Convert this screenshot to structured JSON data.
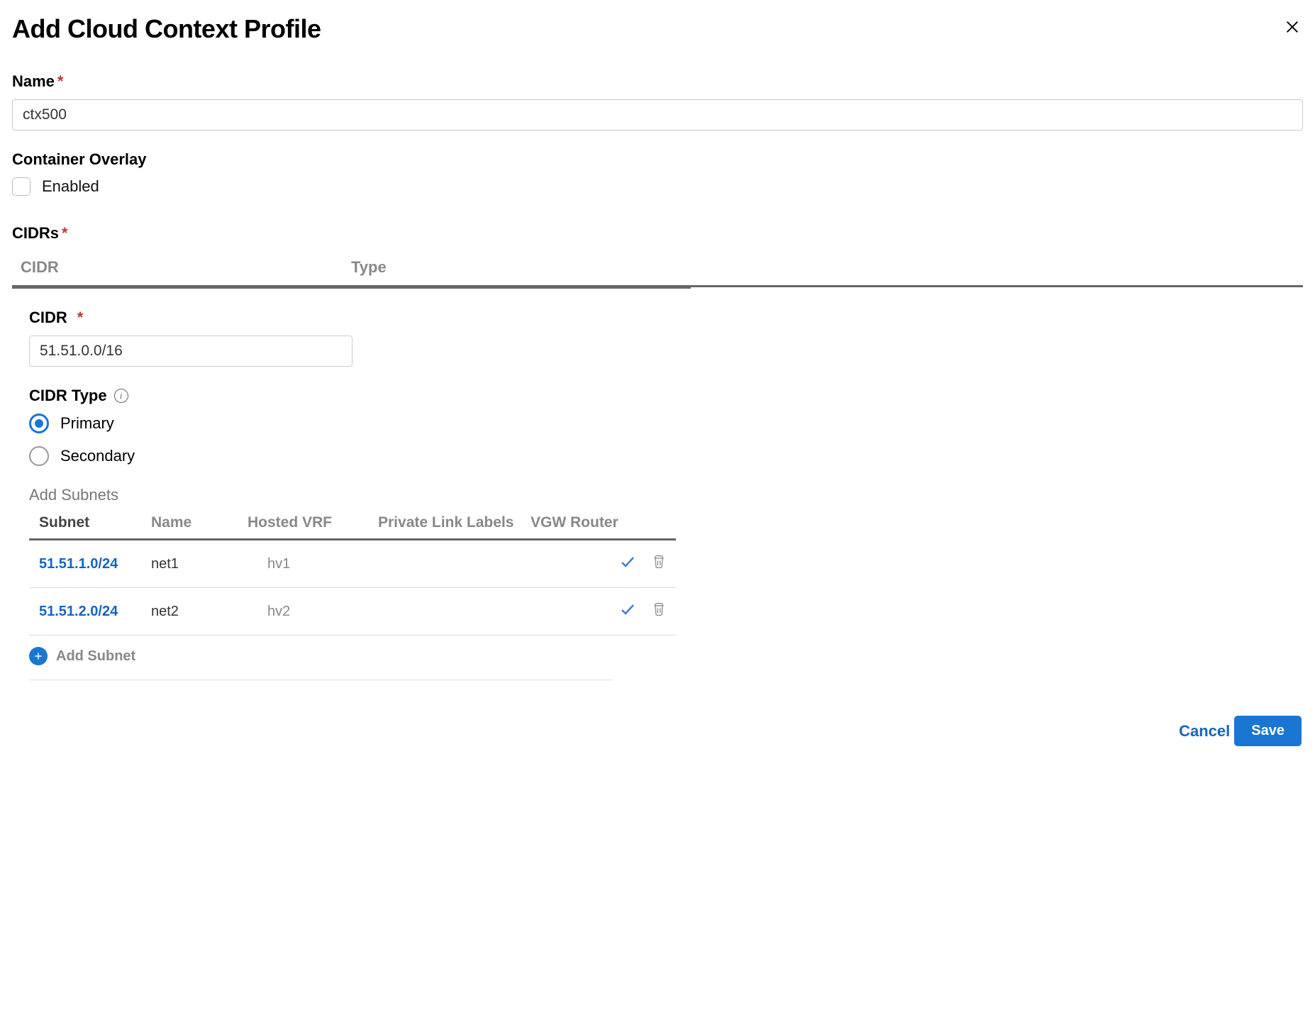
{
  "header": {
    "title": "Add Cloud Context Profile"
  },
  "form": {
    "name_label": "Name",
    "name_value": "ctx500",
    "container_overlay_label": "Container Overlay",
    "enabled_label": "Enabled",
    "cidrs_label": "CIDRs",
    "columns": {
      "cidr": "CIDR",
      "type": "Type"
    },
    "cidr_detail": {
      "cidr_label": "CIDR",
      "cidr_value": "51.51.0.0/16",
      "cidr_type_label": "CIDR Type",
      "radio_primary": "Primary",
      "radio_secondary": "Secondary",
      "selected_type": "Primary",
      "add_subnets_label": "Add Subnets",
      "subnet_columns": {
        "subnet": "Subnet",
        "name": "Name",
        "hosted_vrf": "Hosted VRF",
        "pll": "Private Link Labels",
        "vgw": "VGW Router"
      },
      "subnets": [
        {
          "subnet": "51.51.1.0/24",
          "name": "net1",
          "hosted_vrf": "hv1",
          "pll": "",
          "vgw": ""
        },
        {
          "subnet": "51.51.2.0/24",
          "name": "net2",
          "hosted_vrf": "hv2",
          "pll": "",
          "vgw": ""
        }
      ],
      "add_subnet_button": "Add Subnet"
    }
  },
  "footer": {
    "cancel": "Cancel",
    "save": "Save"
  }
}
